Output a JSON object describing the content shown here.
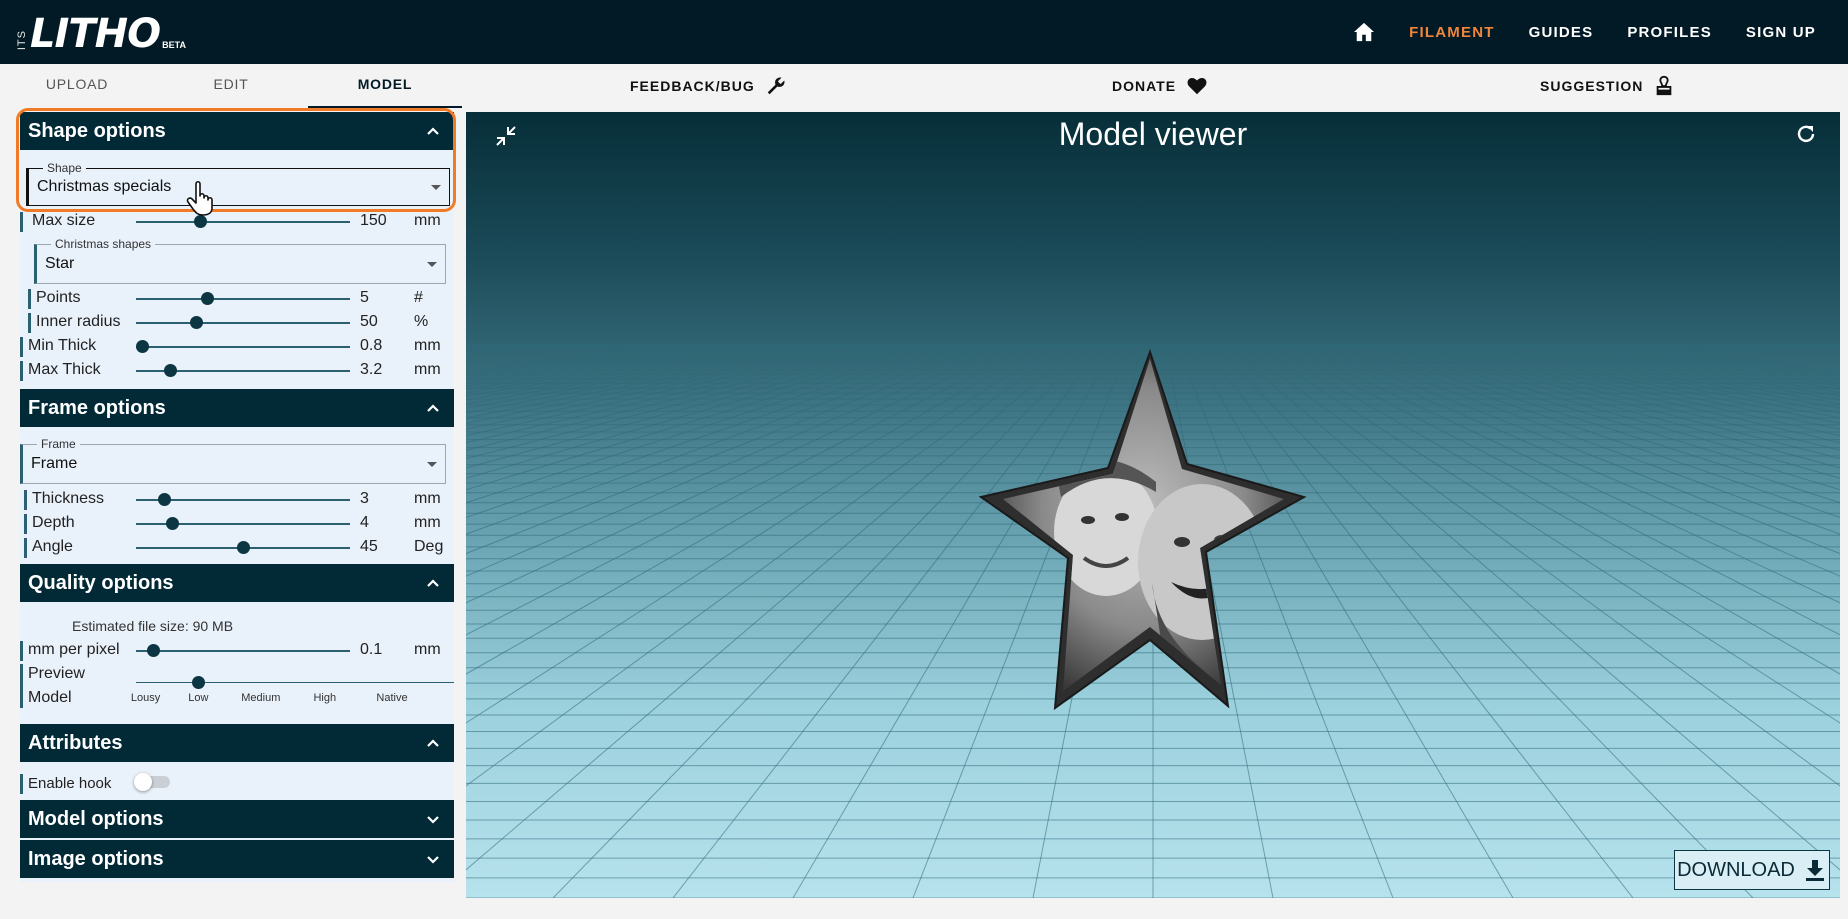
{
  "logo": {
    "prefix": "ITS",
    "main": "LITHO",
    "badge": "BETA"
  },
  "nav": {
    "filament": "FILAMENT",
    "guides": "GUIDES",
    "profiles": "PROFILES",
    "signup": "SIGN UP"
  },
  "tabs": {
    "upload": "UPLOAD",
    "edit": "EDIT",
    "model": "MODEL"
  },
  "subbar": {
    "feedback": "FEEDBACK/BUG",
    "donate": "DONATE",
    "suggestion": "SUGGESTION"
  },
  "shape_options": {
    "title": "Shape options",
    "shape": {
      "label": "Shape",
      "value": "Christmas specials"
    },
    "max_size": {
      "label": "Max size",
      "value": "150",
      "unit": "mm",
      "fraction": 0.3
    },
    "christmas_shapes": {
      "label": "Christmas shapes",
      "value": "Star"
    },
    "points": {
      "label": "Points",
      "value": "5",
      "unit": "#",
      "fraction": 0.33
    },
    "inner_radius": {
      "label": "Inner radius",
      "value": "50",
      "unit": "%",
      "fraction": 0.28
    },
    "min_thick": {
      "label": "Min Thick",
      "value": "0.8",
      "unit": "mm",
      "fraction": 0.03
    },
    "max_thick": {
      "label": "Max Thick",
      "value": "3.2",
      "unit": "mm",
      "fraction": 0.16
    }
  },
  "frame_options": {
    "title": "Frame options",
    "frame": {
      "label": "Frame",
      "value": "Frame"
    },
    "thickness": {
      "label": "Thickness",
      "value": "3",
      "unit": "mm",
      "fraction": 0.13
    },
    "depth": {
      "label": "Depth",
      "value": "4",
      "unit": "mm",
      "fraction": 0.17
    },
    "angle": {
      "label": "Angle",
      "value": "45",
      "unit": "Deg",
      "fraction": 0.5
    }
  },
  "quality_options": {
    "title": "Quality options",
    "file_size": "Estimated file size: 90 MB",
    "mm_per_pixel": {
      "label": "mm per pixel",
      "value": "0.1",
      "unit": "mm",
      "fraction": 0.08
    },
    "preview_label": "Preview",
    "model_label": "Model",
    "levels": [
      "Lousy",
      "Low",
      "Medium",
      "High",
      "Native"
    ],
    "selected_level": "Low"
  },
  "attributes": {
    "title": "Attributes",
    "enable_hook": "Enable hook",
    "hook_enabled": false
  },
  "model_options": {
    "title": "Model options"
  },
  "image_options": {
    "title": "Image options"
  },
  "viewer": {
    "title": "Model viewer",
    "download": "DOWNLOAD"
  },
  "colors": {
    "navy": "#021a26",
    "accent": "#f0863a",
    "panel": "#e9f1fb",
    "highlight": "#f07a26"
  }
}
